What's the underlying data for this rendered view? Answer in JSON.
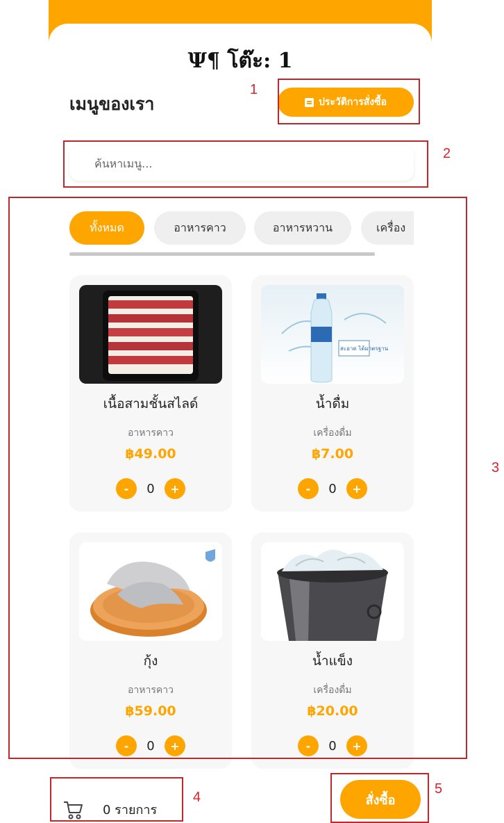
{
  "header": {
    "table_icon": "fork-knife-icon",
    "table_label": "Ψ¶ โต๊ะ: 1",
    "accent_color": "#FFA500"
  },
  "menu": {
    "heading": "เมนูของเรา",
    "history_button_label": "ประวัติการสั่งซื้อ"
  },
  "search": {
    "placeholder": "ค้นหาเมนู..."
  },
  "tabs": [
    {
      "label": "ทั้งหมด",
      "active": true
    },
    {
      "label": "อาหารคาว",
      "active": false
    },
    {
      "label": "อาหารหวาน",
      "active": false
    },
    {
      "label": "เครื่อง",
      "active": false
    }
  ],
  "products": [
    {
      "name": "เนื้อสามชั้นสไลด์",
      "category": "อาหารคาว",
      "price": "฿49.00",
      "qty": "0",
      "image": "sliced-beef"
    },
    {
      "name": "น้ำดื่ม",
      "category": "เครื่องดื่ม",
      "price": "฿7.00",
      "qty": "0",
      "image": "water-bottle"
    },
    {
      "name": "กุ้ง",
      "category": "อาหารคาว",
      "price": "฿59.00",
      "qty": "0",
      "image": "shrimp-platter"
    },
    {
      "name": "น้ำแข็ง",
      "category": "เครื่องดื่ม",
      "price": "฿20.00",
      "qty": "0",
      "image": "ice-bucket"
    }
  ],
  "water_label": "สะอาด ได้มาตรฐาน",
  "qty_controls": {
    "minus": "-",
    "plus": "+"
  },
  "footer": {
    "cart_icon": "cart-icon",
    "cart_text": "0 รายการ",
    "order_button_label": "สั่งซื้อ"
  },
  "annotations": [
    "1",
    "2",
    "3",
    "4",
    "5"
  ]
}
